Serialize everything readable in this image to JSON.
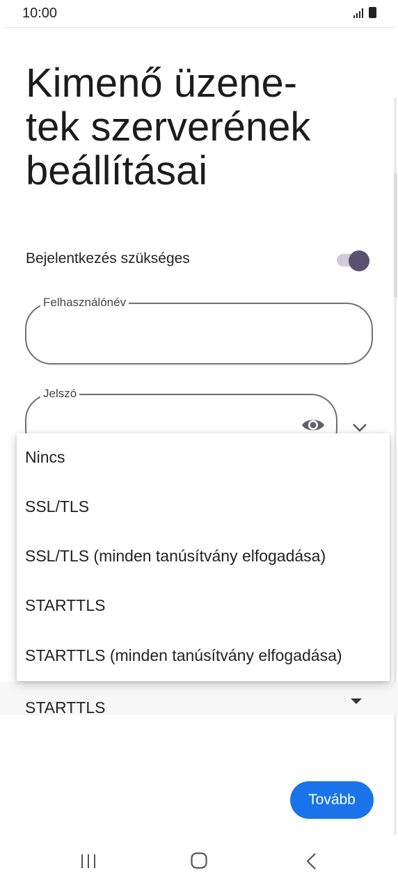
{
  "status_bar": {
    "time": "10:00",
    "icons": [
      "signal-icon",
      "battery-icon"
    ]
  },
  "page": {
    "title": "Kimenő üzene-tek szerverének beállításai"
  },
  "login_required": {
    "label": "Bejelentkezés szükséges",
    "enabled": true
  },
  "fields": {
    "username": {
      "label": "Felhasználónév",
      "value": ""
    },
    "password": {
      "label": "Jelszó",
      "value": ""
    }
  },
  "security_menu": {
    "items": [
      "Nincs",
      "SSL/TLS",
      "SSL/TLS (minden tanúsítvány elfogadása)",
      "STARTTLS",
      "STARTTLS (minden tanúsítvány elfogadása)"
    ]
  },
  "security_select": {
    "value": "STARTTLS"
  },
  "buttons": {
    "next": "Tovább"
  },
  "colors": {
    "accent": "#1a73e8",
    "toggle_thumb": "#5a5370",
    "toggle_track": "#cfcbd8"
  }
}
